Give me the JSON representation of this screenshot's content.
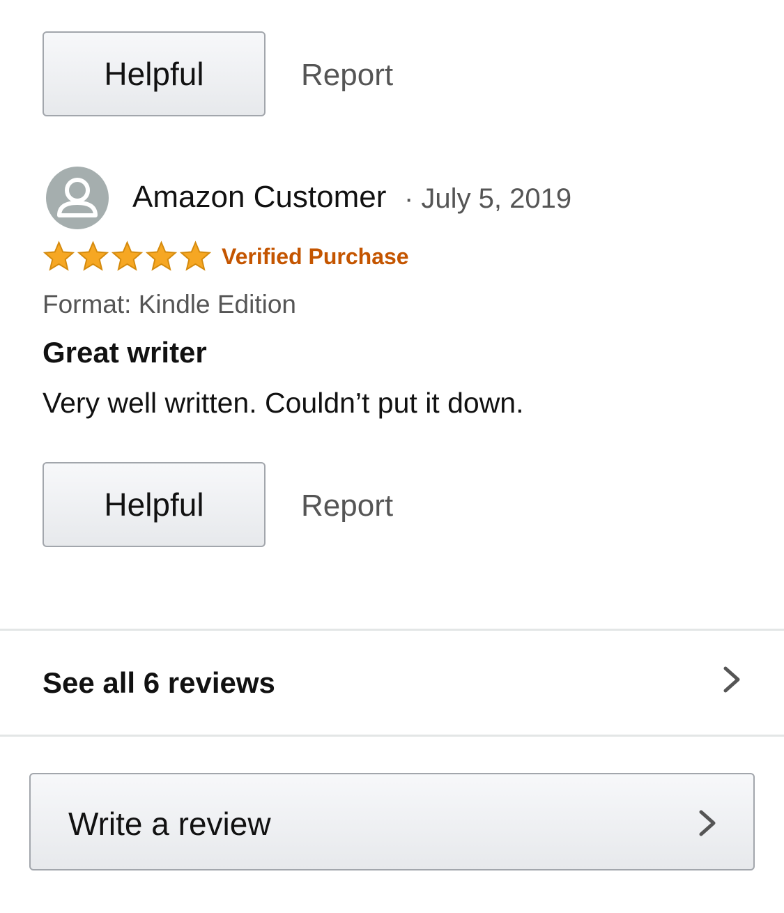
{
  "top_actions": {
    "helpful_label": "Helpful",
    "report_label": "Report"
  },
  "review": {
    "reviewer_name": "Amazon Customer",
    "date": "· July 5, 2019",
    "rating": 5,
    "rating_max": 5,
    "verified_label": "Verified Purchase",
    "format": "Format: Kindle Edition",
    "title": "Great writer",
    "body": "Very well written. Couldn’t put it down.",
    "helpful_label": "Helpful",
    "report_label": "Report"
  },
  "see_all": {
    "label": "See all 6 reviews"
  },
  "write_review": {
    "label": "Write a review"
  },
  "colors": {
    "star": "#f6a723",
    "verified": "#c45500",
    "avatar": "#a5aeae",
    "divider": "#e3e6e6"
  },
  "icons": {
    "avatar": "user-avatar-icon",
    "star": "star-icon",
    "chevron": "chevron-right-icon"
  }
}
